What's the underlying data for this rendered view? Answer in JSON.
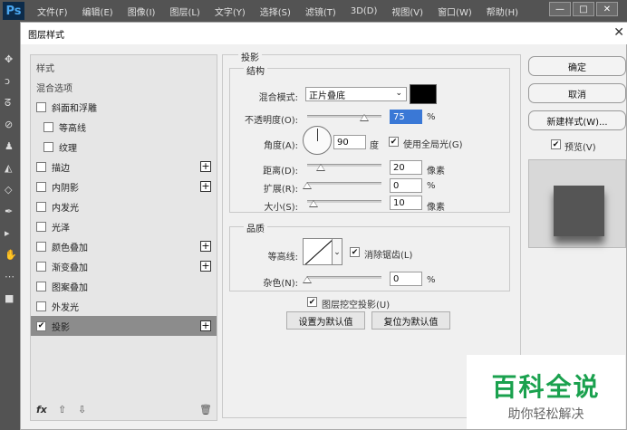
{
  "app": {
    "logo": "Ps",
    "menu": [
      "文件(F)",
      "编辑(E)",
      "图像(I)",
      "图层(L)",
      "文字(Y)",
      "选择(S)",
      "滤镜(T)",
      "3D(D)",
      "视图(V)",
      "窗口(W)",
      "帮助(H)"
    ],
    "window_buttons": [
      "—",
      "□",
      "✕"
    ]
  },
  "dialog": {
    "title": "图层样式",
    "close": "✕"
  },
  "style_list": {
    "items": [
      {
        "label": "样式",
        "type": "header"
      },
      {
        "label": "混合选项",
        "type": "header"
      },
      {
        "label": "斜面和浮雕",
        "checked": false
      },
      {
        "label": "等高线",
        "checked": false,
        "indent": true
      },
      {
        "label": "纹理",
        "checked": false,
        "indent": true
      },
      {
        "label": "描边",
        "checked": false,
        "plus": true
      },
      {
        "label": "内阴影",
        "checked": false,
        "plus": true
      },
      {
        "label": "内发光",
        "checked": false
      },
      {
        "label": "光泽",
        "checked": false
      },
      {
        "label": "颜色叠加",
        "checked": false,
        "plus": true
      },
      {
        "label": "渐变叠加",
        "checked": false,
        "plus": true
      },
      {
        "label": "图案叠加",
        "checked": false
      },
      {
        "label": "外发光",
        "checked": false
      },
      {
        "label": "投影",
        "checked": true,
        "plus": true,
        "selected": true
      }
    ],
    "footer": {
      "fx": "fx",
      "up": "⇧",
      "down": "⇩",
      "trash": "🗑"
    }
  },
  "drop_shadow": {
    "section_title": "投影",
    "structure": {
      "title": "结构",
      "blend_mode_label": "混合模式:",
      "blend_mode_value": "正片叠底",
      "blend_color": "#000000",
      "opacity_label": "不透明度(O):",
      "opacity_value": "75",
      "opacity_unit": "%",
      "angle_label": "角度(A):",
      "angle_value": "90",
      "angle_unit": "度",
      "global_light_label": "使用全局光(G)",
      "global_light_checked": true,
      "distance_label": "距离(D):",
      "distance_value": "20",
      "distance_unit": "像素",
      "spread_label": "扩展(R):",
      "spread_value": "0",
      "spread_unit": "%",
      "size_label": "大小(S):",
      "size_value": "10",
      "size_unit": "像素"
    },
    "quality": {
      "title": "品质",
      "contour_label": "等高线:",
      "antialias_label": "消除锯齿(L)",
      "antialias_checked": true,
      "noise_label": "杂色(N):",
      "noise_value": "0",
      "noise_unit": "%"
    },
    "knockout_label": "图层挖空投影(U)",
    "knockout_checked": true,
    "set_default": "设置为默认值",
    "reset_default": "复位为默认值"
  },
  "buttons": {
    "ok": "确定",
    "cancel": "取消",
    "new_style": "新建样式(W)...",
    "preview_label": "预览(V)",
    "preview_checked": true
  },
  "watermark": {
    "main": "百科全说",
    "sub": "助你轻松解决"
  }
}
